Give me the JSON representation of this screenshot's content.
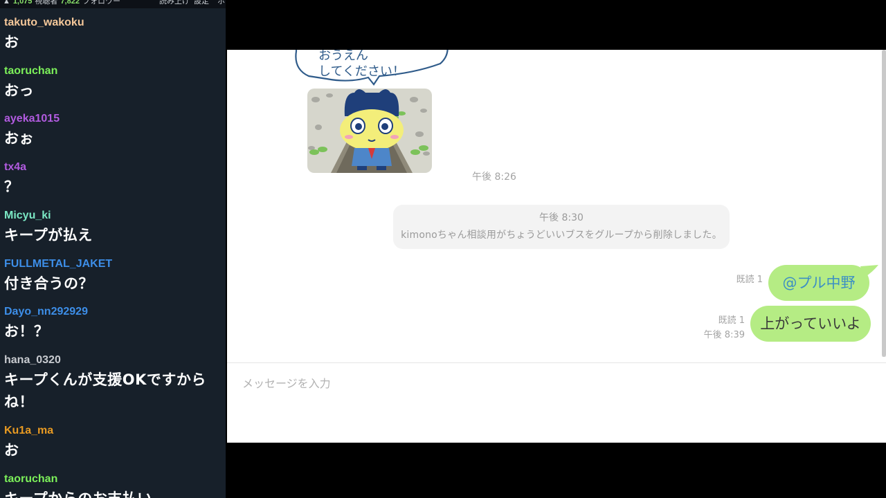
{
  "chat": {
    "topbar": {
      "viewers": "1,075",
      "viewers_label": "視聴者",
      "followers": "7,822",
      "followers_label": "フォロワー",
      "menu": [
        "読み上げ",
        "設定",
        "ホ"
      ]
    },
    "messages": [
      {
        "user": "takuto_wakoku",
        "color": "#f5c89a",
        "text": "お"
      },
      {
        "user": "taoruchan",
        "color": "#7cf05a",
        "text": "おっ"
      },
      {
        "user": "ayeka1015",
        "color": "#b25be0",
        "text": "おぉ"
      },
      {
        "user": "tx4a",
        "color": "#b25be0",
        "text": "？"
      },
      {
        "user": "Micyu_ki",
        "color": "#7be8c4",
        "text": "キープが払え"
      },
      {
        "user": "FULLMETAL_JAKET",
        "color": "#3d8ee8",
        "text": "付き合うの？"
      },
      {
        "user": "Dayo_nn292929",
        "color": "#3d8ee8",
        "text": "お！？"
      },
      {
        "user": "hana_0320",
        "color": "#c8cbd0",
        "text": "キープくんが支援OKですからね！"
      },
      {
        "user": "Ku1a_ma",
        "color": "#e89a22",
        "text": "お"
      },
      {
        "user": "taoruchan",
        "color": "#7cf05a",
        "text": "キープからのお支払い"
      }
    ]
  },
  "line": {
    "sticker": {
      "speech_line1": "おうえん",
      "speech_line2": "してください！"
    },
    "sticker_time": "午後 8:26",
    "notice": {
      "time": "午後 8:30",
      "text": "kimonoちゃん相談用がちょうどいいブスをグループから削除しました。"
    },
    "messages": [
      {
        "read": "既読 1",
        "time": "",
        "text": "@プル中野"
      },
      {
        "read": "既読 1",
        "time": "午後 8:39",
        "text": "上がっていいよ"
      }
    ],
    "input_placeholder": "メッセージを入力",
    "colors": {
      "bubble": "#b5ec84",
      "mention": "#3c8fc4"
    }
  }
}
